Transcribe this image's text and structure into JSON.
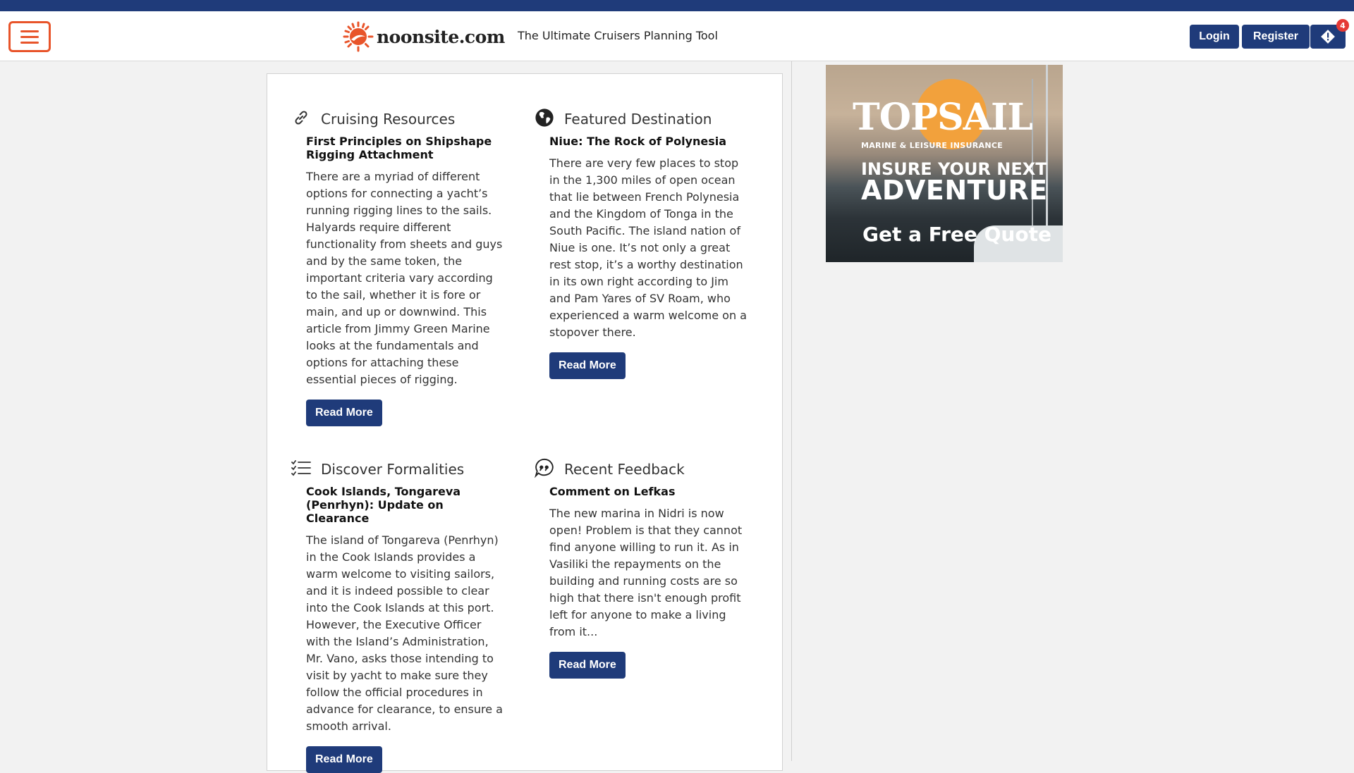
{
  "header": {
    "logo_text": "noonsite.com",
    "tagline": "The Ultimate Cruisers Planning Tool",
    "login_label": "Login",
    "register_label": "Register",
    "alert_count": "4"
  },
  "cards": [
    {
      "title": "Cruising Resources",
      "icon": "link-icon",
      "subtitle": "First Principles on Shipshape Rigging Attachment",
      "body": "There are a myriad of different options for connecting a yacht’s running rigging lines to the sails. Halyards require different functionality from sheets and guys and by the same token, the important criteria vary according to the sail, whether it is fore or main, and up or downwind. This article from Jimmy Green Marine looks at the fundamentals and options for attaching these essential pieces of rigging.",
      "button": "Read More"
    },
    {
      "title": "Featured Destination",
      "icon": "globe-icon",
      "subtitle": "Niue: The Rock of Polynesia",
      "body": "There are very few places to stop in the 1,300 miles of open ocean that lie between French Polynesia and the Kingdom of Tonga in the South Pacific. The island nation of Niue is one. It’s not only a great rest stop, it’s a worthy destination in its own right according to Jim and Pam Yares of SV Roam, who experienced a warm welcome on a stopover there.",
      "button": "Read More"
    },
    {
      "title": "Discover Formalities",
      "icon": "checklist-icon",
      "subtitle": "Cook Islands, Tongareva (Penrhyn): Update on Clearance",
      "body": "The island of Tongareva (Penrhyn) in the Cook Islands provides a warm welcome to visiting sailors, and it is indeed possible to clear into the Cook Islands at this port. However, the Executive Officer with the Island’s Administration, Mr. Vano, asks those intending to visit by yacht to make sure they follow the official procedures in advance for clearance, to ensure a smooth arrival.",
      "button": "Read More"
    },
    {
      "title": "Recent Feedback",
      "icon": "quote-bubble-icon",
      "subtitle": "Comment on Lefkas",
      "body": "The new marina in Nidri is now open! Problem is that they cannot find anyone willing to run it. As in Vasiliki the repayments on the building and running costs are so high that there isn't enough profit left for anyone to make a living from it...",
      "button": "Read More"
    }
  ],
  "ad": {
    "brand": "TOPSAIL",
    "brand_sub": "MARINE & LEISURE INSURANCE",
    "line1": "INSURE YOUR NEXT",
    "line2": "ADVENTURE",
    "cta": "Get a Free Quote"
  },
  "colors": {
    "brand_blue": "#1f3b7a",
    "accent_orange": "#e8542a",
    "badge_red": "#e53935"
  }
}
